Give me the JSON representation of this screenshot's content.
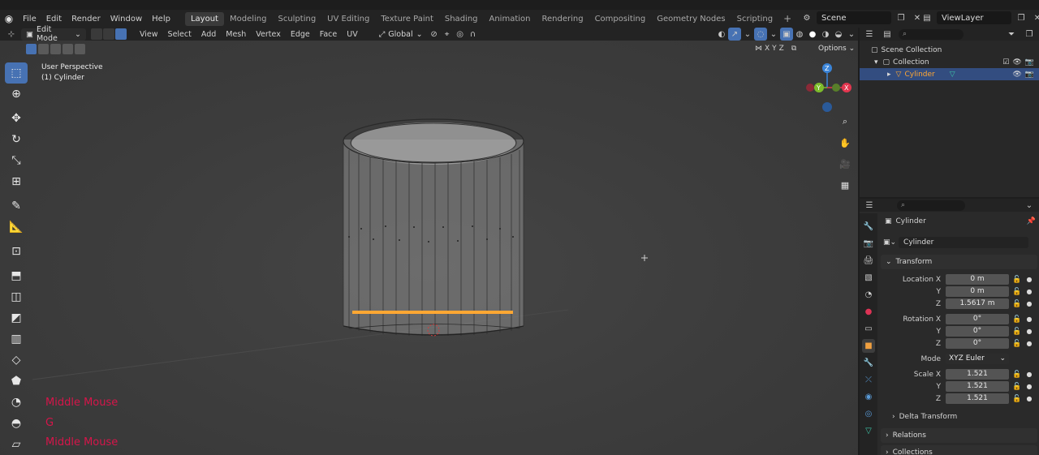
{
  "menubar": {
    "items": [
      "File",
      "Edit",
      "Render",
      "Window",
      "Help"
    ],
    "workspaces": [
      "Layout",
      "Modeling",
      "Sculpting",
      "UV Editing",
      "Texture Paint",
      "Shading",
      "Animation",
      "Rendering",
      "Compositing",
      "Geometry Nodes",
      "Scripting"
    ],
    "active_workspace": "Layout",
    "scene": "Scene",
    "view_layer": "ViewLayer"
  },
  "viewport_header": {
    "mode": "Edit Mode",
    "menus": [
      "View",
      "Select",
      "Add",
      "Mesh",
      "Vertex",
      "Edge",
      "Face",
      "UV"
    ],
    "orientation": "Global",
    "options_label": "Options",
    "axes": [
      "X",
      "Y",
      "Z"
    ]
  },
  "viewport": {
    "perspective": "User Perspective",
    "object": "(1) Cylinder",
    "key_hints": [
      "Middle Mouse",
      "G",
      "Middle Mouse"
    ],
    "gizmo_axes": [
      "Z",
      "X",
      "Y"
    ]
  },
  "outliner": {
    "rows": [
      {
        "label": "Scene Collection"
      },
      {
        "label": "Collection"
      },
      {
        "label": "Cylinder"
      }
    ]
  },
  "properties": {
    "object_name": "Cylinder",
    "data_name": "Cylinder",
    "transform_label": "Transform",
    "location": {
      "label": "Location X",
      "x": "0 m",
      "y": "0 m",
      "z": "1.5617 m"
    },
    "rotation": {
      "label": "Rotation X",
      "x": "0°",
      "y": "0°",
      "z": "0°"
    },
    "mode": {
      "label": "Mode",
      "value": "XYZ Euler"
    },
    "scale": {
      "label": "Scale X",
      "x": "1.521",
      "y": "1.521",
      "z": "1.521"
    },
    "axis_y": "Y",
    "axis_z": "Z",
    "delta_transform": "Delta Transform",
    "relations": "Relations",
    "collections": "Collections"
  },
  "colors": {
    "accent": "#4772b3",
    "selected_orange": "#ffa733",
    "hint_red": "#d6154a",
    "axis_x": "#e3364f",
    "axis_y": "#7dbb2b",
    "axis_z": "#3a84d8"
  }
}
